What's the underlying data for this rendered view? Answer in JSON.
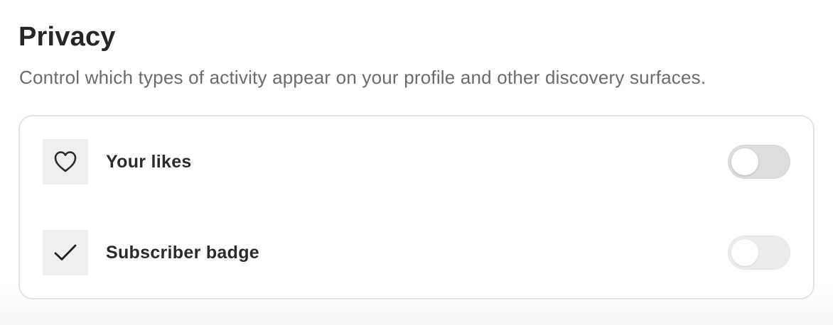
{
  "privacy": {
    "title": "Privacy",
    "description": "Control which types of activity appear on your profile and other discovery surfaces.",
    "settings": [
      {
        "label": "Your likes",
        "icon": "heart-icon",
        "enabled": false
      },
      {
        "label": "Subscriber badge",
        "icon": "checkmark-icon",
        "enabled": false
      }
    ]
  },
  "colors": {
    "text_primary": "#262626",
    "text_secondary": "#6b6b6b",
    "card_border": "#e3e3e3",
    "icon_background": "#efefef",
    "toggle_off": "#dedede"
  }
}
